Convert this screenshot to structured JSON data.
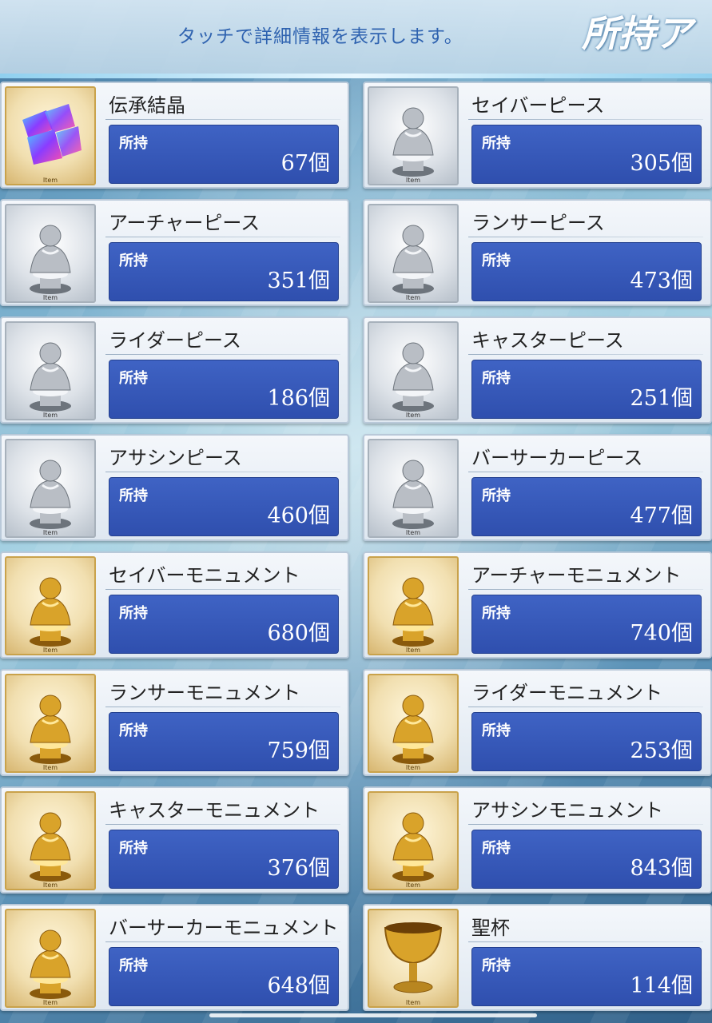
{
  "header": {
    "hint": "タッチで詳細情報を表示します。",
    "title": "所持ア"
  },
  "thumb_tag": "Item",
  "items": [
    {
      "name": "伝承結晶",
      "label": "所持",
      "count": "67個",
      "tier": "crystal",
      "icon": "crystal-icon"
    },
    {
      "name": "セイバーピース",
      "label": "所持",
      "count": "305個",
      "tier": "silver",
      "icon": "saber-statue-icon"
    },
    {
      "name": "アーチャーピース",
      "label": "所持",
      "count": "351個",
      "tier": "silver",
      "icon": "archer-statue-icon"
    },
    {
      "name": "ランサーピース",
      "label": "所持",
      "count": "473個",
      "tier": "silver",
      "icon": "lancer-statue-icon"
    },
    {
      "name": "ライダーピース",
      "label": "所持",
      "count": "186個",
      "tier": "silver",
      "icon": "rider-statue-icon"
    },
    {
      "name": "キャスターピース",
      "label": "所持",
      "count": "251個",
      "tier": "silver",
      "icon": "caster-statue-icon"
    },
    {
      "name": "アサシンピース",
      "label": "所持",
      "count": "460個",
      "tier": "silver",
      "icon": "assassin-statue-icon"
    },
    {
      "name": "バーサーカーピース",
      "label": "所持",
      "count": "477個",
      "tier": "silver",
      "icon": "berserker-statue-icon"
    },
    {
      "name": "セイバーモニュメント",
      "label": "所持",
      "count": "680個",
      "tier": "gold",
      "icon": "saber-statue-icon"
    },
    {
      "name": "アーチャーモニュメント",
      "label": "所持",
      "count": "740個",
      "tier": "gold",
      "icon": "archer-statue-icon"
    },
    {
      "name": "ランサーモニュメント",
      "label": "所持",
      "count": "759個",
      "tier": "gold",
      "icon": "lancer-statue-icon"
    },
    {
      "name": "ライダーモニュメント",
      "label": "所持",
      "count": "253個",
      "tier": "gold",
      "icon": "rider-statue-icon"
    },
    {
      "name": "キャスターモニュメント",
      "label": "所持",
      "count": "376個",
      "tier": "gold",
      "icon": "caster-statue-icon"
    },
    {
      "name": "アサシンモニュメント",
      "label": "所持",
      "count": "843個",
      "tier": "gold",
      "icon": "assassin-statue-icon"
    },
    {
      "name": "バーサーカーモニュメント",
      "label": "所持",
      "count": "648個",
      "tier": "gold",
      "icon": "berserker-statue-icon"
    },
    {
      "name": "聖杯",
      "label": "所持",
      "count": "114個",
      "tier": "gold",
      "icon": "holy-grail-icon"
    }
  ]
}
